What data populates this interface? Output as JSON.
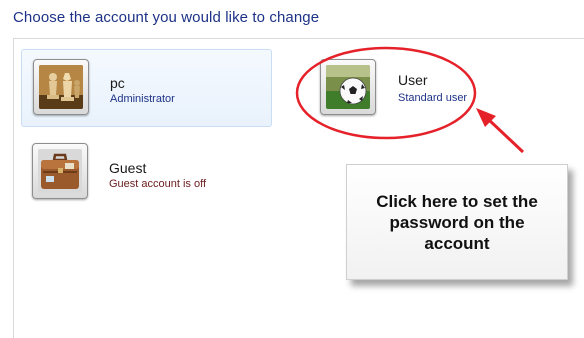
{
  "page": {
    "title": "Choose the account you would like to change"
  },
  "accounts": [
    {
      "name": "pc",
      "type": "Administrator",
      "avatar_icon": "chess-pieces-icon"
    },
    {
      "name": "User",
      "type": "Standard user",
      "avatar_icon": "soccer-ball-icon"
    },
    {
      "name": "Guest",
      "type": "Guest account is off",
      "avatar_icon": "briefcase-icon"
    }
  ],
  "annotation": {
    "callout_text": "Click here to set the password on the account",
    "highlight_color": "#e5212a",
    "arrow_color": "#e5212a"
  },
  "colors": {
    "title": "#1e3287",
    "account_type": "#1e3287",
    "guest_status": "#6b1c1c",
    "selected_bg": "#eef5fd"
  }
}
